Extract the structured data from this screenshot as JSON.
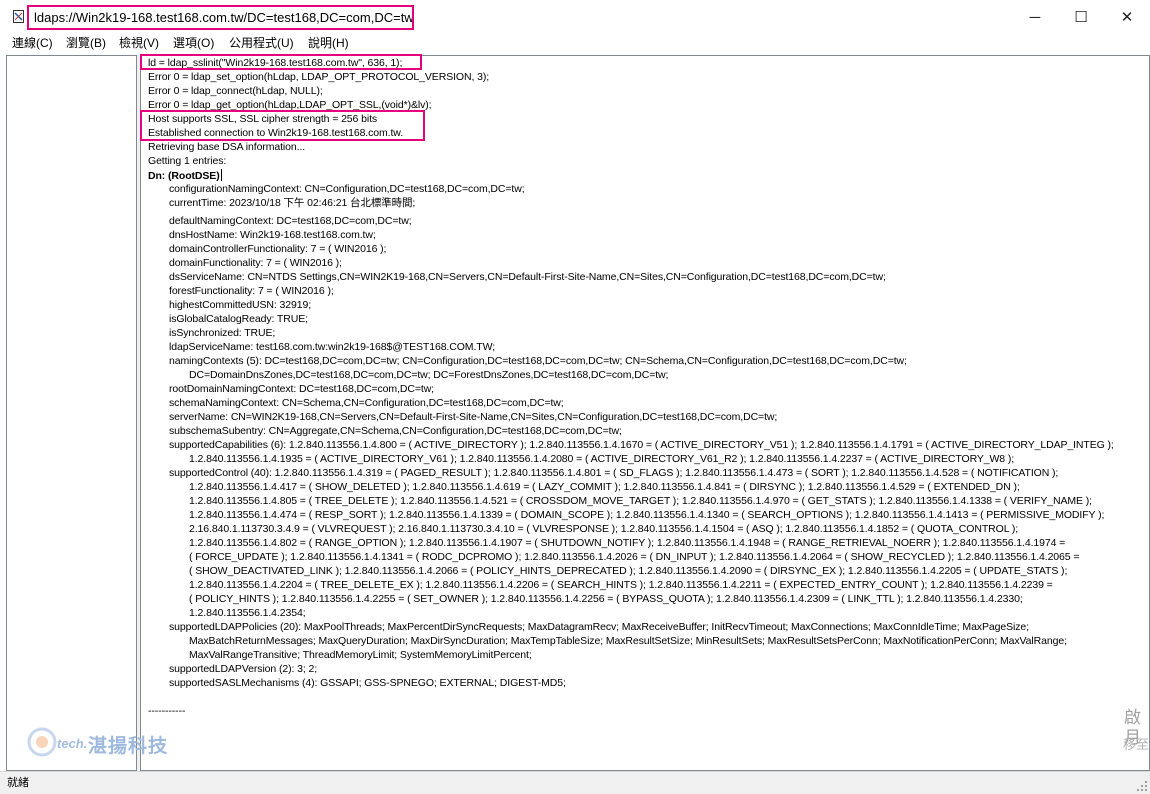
{
  "window": {
    "title": "ldaps://Win2k19-168.test168.com.tw/DC=test168,DC=com,DC=tw",
    "minimize_glyph": "─",
    "maximize_glyph": "☐",
    "close_glyph": "✕"
  },
  "menu": [
    {
      "label": "連線(C)"
    },
    {
      "label": "瀏覽(B)"
    },
    {
      "label": "檢視(V)"
    },
    {
      "label": "選項(O)"
    },
    {
      "label": "公用程式(U)"
    },
    {
      "label": "說明(H)"
    }
  ],
  "output": {
    "lines": [
      "ld = ldap_sslinit(\"Win2k19-168.test168.com.tw\", 636, 1);",
      "Error 0 = ldap_set_option(hLdap, LDAP_OPT_PROTOCOL_VERSION, 3);",
      "Error 0 = ldap_connect(hLdap, NULL);",
      "Error 0 = ldap_get_option(hLdap,LDAP_OPT_SSL,(void*)&lv);",
      "Host supports SSL, SSL cipher strength = 256 bits",
      "Established connection to Win2k19-168.test168.com.tw.",
      "Retrieving base DSA information...",
      "Getting 1 entries:",
      "Dn: (RootDSE)",
      "configurationNamingContext: CN=Configuration,DC=test168,DC=com,DC=tw;",
      "currentTime: 2023/10/18 下午 02:46:21 台北標準時間;",
      "defaultNamingContext: DC=test168,DC=com,DC=tw;",
      "dnsHostName: Win2k19-168.test168.com.tw;",
      "domainControllerFunctionality: 7 = ( WIN2016 );",
      "domainFunctionality: 7 = ( WIN2016 );",
      "dsServiceName: CN=NTDS Settings,CN=WIN2K19-168,CN=Servers,CN=Default-First-Site-Name,CN=Sites,CN=Configuration,DC=test168,DC=com,DC=tw;",
      "forestFunctionality: 7 = ( WIN2016 );",
      "highestCommittedUSN: 32919;",
      "isGlobalCatalogReady: TRUE;",
      "isSynchronized: TRUE;",
      "ldapServiceName: test168.com.tw:win2k19-168$@TEST168.COM.TW;",
      "namingContexts (5): DC=test168,DC=com,DC=tw; CN=Configuration,DC=test168,DC=com,DC=tw; CN=Schema,CN=Configuration,DC=test168,DC=com,DC=tw;",
      "DC=DomainDnsZones,DC=test168,DC=com,DC=tw; DC=ForestDnsZones,DC=test168,DC=com,DC=tw;",
      "rootDomainNamingContext: DC=test168,DC=com,DC=tw;",
      "schemaNamingContext: CN=Schema,CN=Configuration,DC=test168,DC=com,DC=tw;",
      "serverName: CN=WIN2K19-168,CN=Servers,CN=Default-First-Site-Name,CN=Sites,CN=Configuration,DC=test168,DC=com,DC=tw;",
      "subschemaSubentry: CN=Aggregate,CN=Schema,CN=Configuration,DC=test168,DC=com,DC=tw;",
      "supportedCapabilities (6): 1.2.840.113556.1.4.800 = ( ACTIVE_DIRECTORY ); 1.2.840.113556.1.4.1670 = ( ACTIVE_DIRECTORY_V51 ); 1.2.840.113556.1.4.1791 = ( ACTIVE_DIRECTORY_LDAP_INTEG );",
      "1.2.840.113556.1.4.1935 = ( ACTIVE_DIRECTORY_V61 ); 1.2.840.113556.1.4.2080 = ( ACTIVE_DIRECTORY_V61_R2 ); 1.2.840.113556.1.4.2237 = ( ACTIVE_DIRECTORY_W8 );",
      "supportedControl (40): 1.2.840.113556.1.4.319 = ( PAGED_RESULT ); 1.2.840.113556.1.4.801 = ( SD_FLAGS ); 1.2.840.113556.1.4.473 = ( SORT ); 1.2.840.113556.1.4.528 = ( NOTIFICATION );",
      "1.2.840.113556.1.4.417 = ( SHOW_DELETED ); 1.2.840.113556.1.4.619 = ( LAZY_COMMIT ); 1.2.840.113556.1.4.841 = ( DIRSYNC ); 1.2.840.113556.1.4.529 = ( EXTENDED_DN );",
      "1.2.840.113556.1.4.805 = ( TREE_DELETE ); 1.2.840.113556.1.4.521 = ( CROSSDOM_MOVE_TARGET ); 1.2.840.113556.1.4.970 = ( GET_STATS ); 1.2.840.113556.1.4.1338 = ( VERIFY_NAME );",
      "1.2.840.113556.1.4.474 = ( RESP_SORT ); 1.2.840.113556.1.4.1339 = ( DOMAIN_SCOPE ); 1.2.840.113556.1.4.1340 = ( SEARCH_OPTIONS ); 1.2.840.113556.1.4.1413 = ( PERMISSIVE_MODIFY );",
      "2.16.840.1.113730.3.4.9 = ( VLVREQUEST ); 2.16.840.1.113730.3.4.10 = ( VLVRESPONSE ); 1.2.840.113556.1.4.1504 = ( ASQ ); 1.2.840.113556.1.4.1852 = ( QUOTA_CONTROL );",
      "1.2.840.113556.1.4.802 = ( RANGE_OPTION ); 1.2.840.113556.1.4.1907 = ( SHUTDOWN_NOTIFY ); 1.2.840.113556.1.4.1948 = ( RANGE_RETRIEVAL_NOERR ); 1.2.840.113556.1.4.1974 =",
      "( FORCE_UPDATE ); 1.2.840.113556.1.4.1341 = ( RODC_DCPROMO ); 1.2.840.113556.1.4.2026 = ( DN_INPUT ); 1.2.840.113556.1.4.2064 = ( SHOW_RECYCLED ); 1.2.840.113556.1.4.2065 =",
      "( SHOW_DEACTIVATED_LINK ); 1.2.840.113556.1.4.2066 = ( POLICY_HINTS_DEPRECATED ); 1.2.840.113556.1.4.2090 = ( DIRSYNC_EX ); 1.2.840.113556.1.4.2205 = ( UPDATE_STATS );",
      "1.2.840.113556.1.4.2204 = ( TREE_DELETE_EX ); 1.2.840.113556.1.4.2206 = ( SEARCH_HINTS ); 1.2.840.113556.1.4.2211 = ( EXPECTED_ENTRY_COUNT ); 1.2.840.113556.1.4.2239 =",
      "( POLICY_HINTS ); 1.2.840.113556.1.4.2255 = ( SET_OWNER ); 1.2.840.113556.1.4.2256 = ( BYPASS_QUOTA ); 1.2.840.113556.1.4.2309 = ( LINK_TTL ); 1.2.840.113556.1.4.2330;",
      "1.2.840.113556.1.4.2354;",
      "supportedLDAPPolicies (20): MaxPoolThreads; MaxPercentDirSyncRequests; MaxDatagramRecv; MaxReceiveBuffer; InitRecvTimeout; MaxConnections; MaxConnIdleTime; MaxPageSize;",
      "MaxBatchReturnMessages; MaxQueryDuration; MaxDirSyncDuration; MaxTempTableSize; MaxResultSetSize; MinResultSets; MaxResultSetsPerConn; MaxNotificationPerConn; MaxValRange;",
      "MaxValRangeTransitive; ThreadMemoryLimit; SystemMemoryLimitPercent;",
      "supportedLDAPVersion (2): 3; 2;",
      "supportedSASLMechanisms (4): GSSAPI; GSS-SPNEGO; EXTERNAL; DIGEST-MD5;",
      "-----------"
    ]
  },
  "watermark": {
    "brand": "湛揚科技",
    "tech": "tech.",
    "activate_1": "啟月",
    "activate_2": "移至"
  },
  "status": {
    "text": "就緒"
  },
  "colors": {
    "highlight": "#e6007e",
    "pane_border": "#828790",
    "status_bg": "#f0f0f0"
  }
}
